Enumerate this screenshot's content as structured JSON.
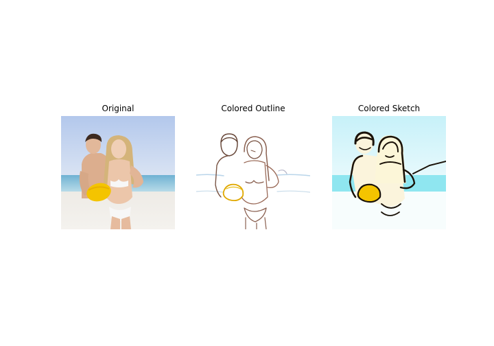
{
  "panels": [
    {
      "title": "Original"
    },
    {
      "title": "Colored Outline"
    },
    {
      "title": "Colored Sketch"
    }
  ],
  "colors": {
    "background": "#ffffff",
    "sky_top": "#b3c8ec",
    "sea": "#7cb8d6",
    "sand": "#ede9e4",
    "skin": "#e9c3a6",
    "hair_blonde": "#d4b47a",
    "hair_dark": "#3d2a20",
    "ball_yellow": "#f4c400",
    "sketch_cyan": "#bff0f8",
    "sketch_line": "#1a1208",
    "outline_line": "#7a5545"
  }
}
